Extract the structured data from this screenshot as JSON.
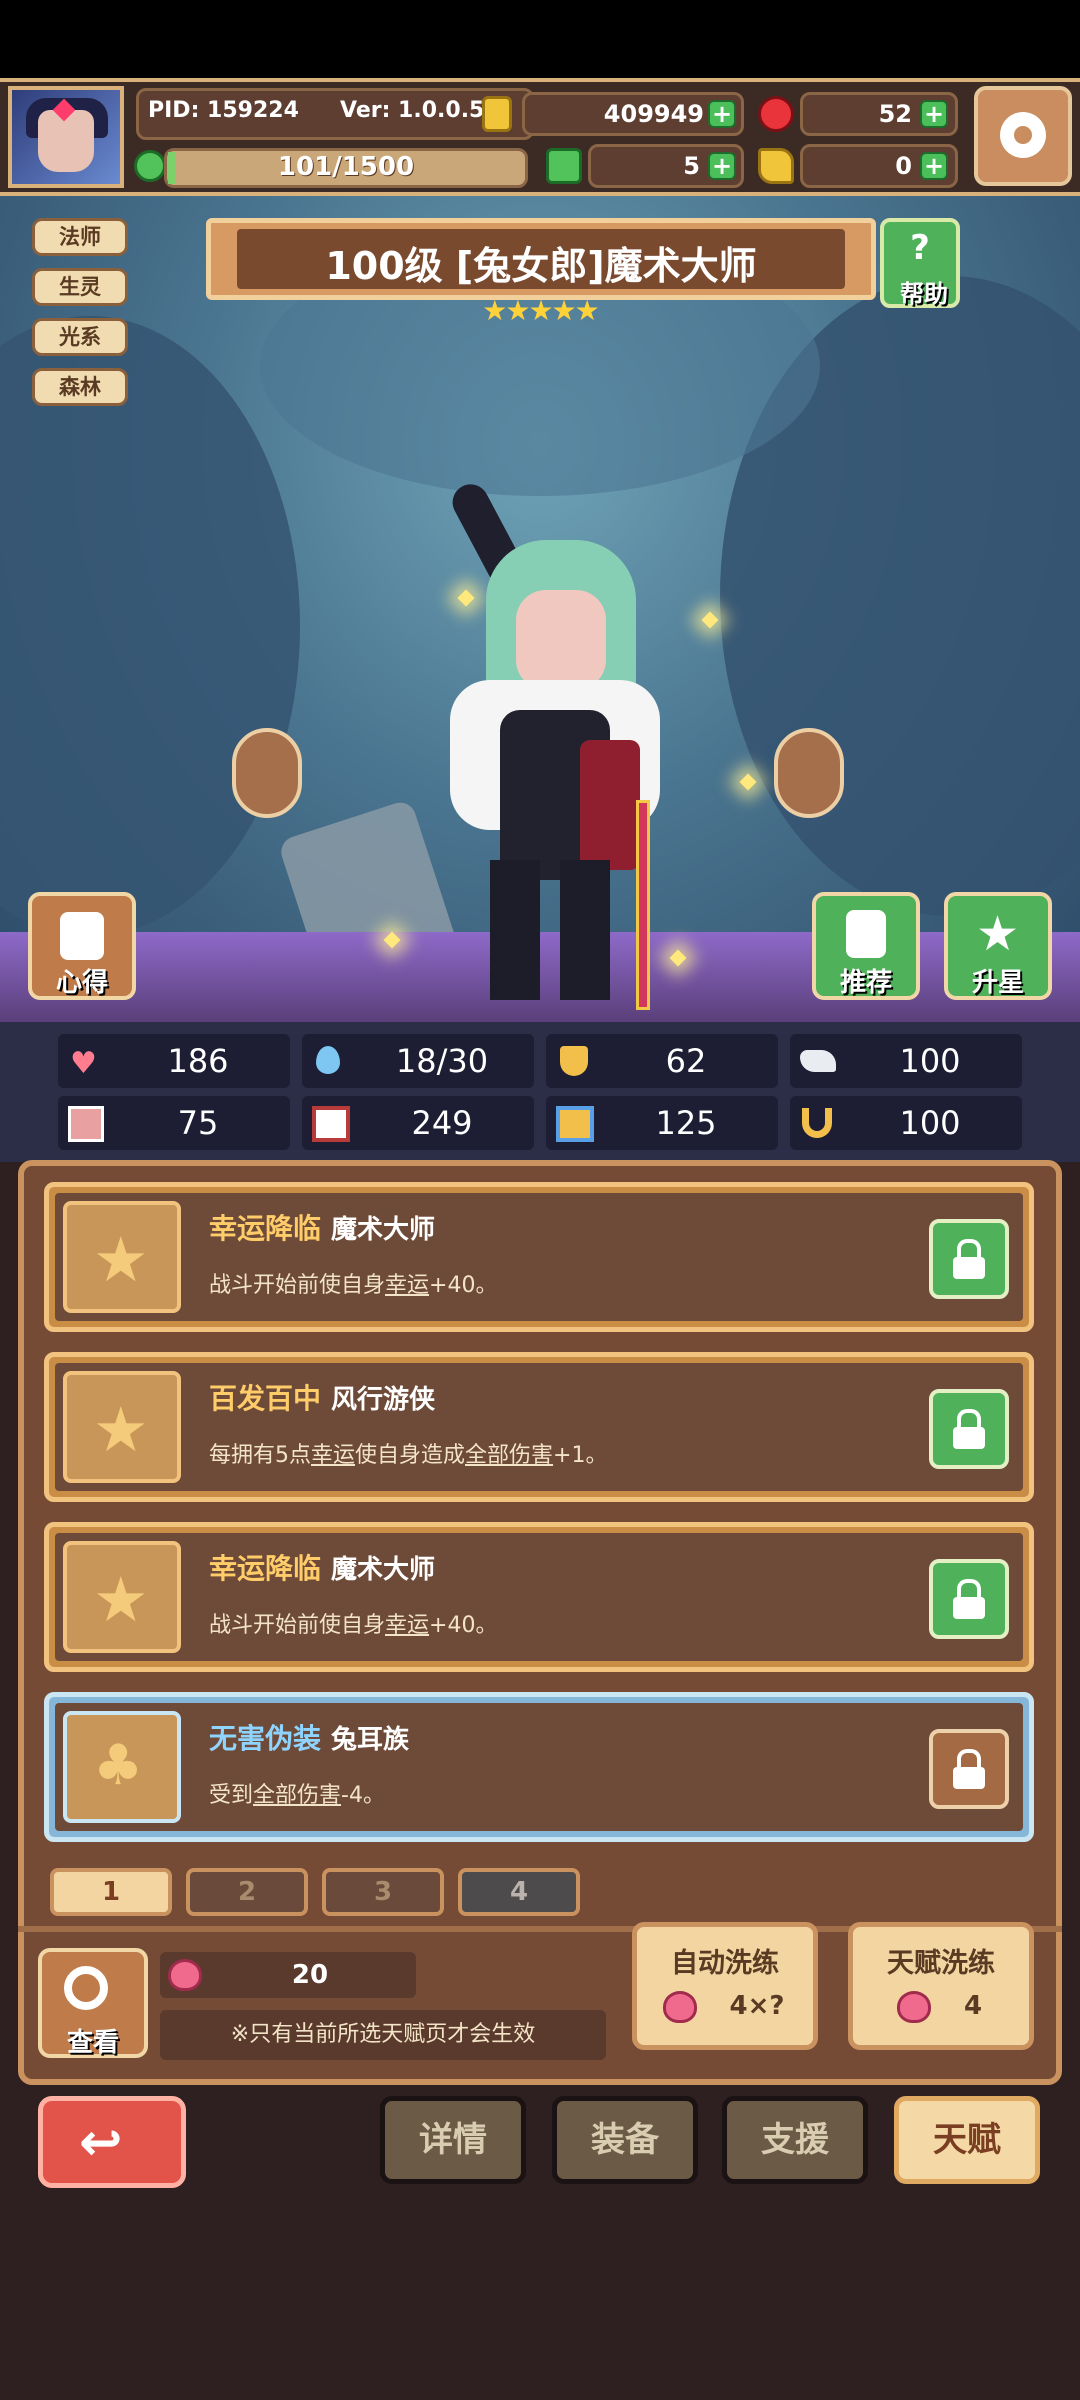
{
  "header": {
    "pid": "PID: 159224",
    "version": "Ver: 1.0.0.5",
    "gold": "409949",
    "gems": "52",
    "energy": "101/1500",
    "clover": "5",
    "key": "0"
  },
  "character": {
    "tags": [
      "法师",
      "生灵",
      "光系",
      "森林"
    ],
    "title": "100级  [兔女郎]魔术大师",
    "stars": "★★★★★",
    "help_label": "帮助",
    "tips_label": "心得",
    "recommend_label": "推荐",
    "star_up_label": "升星"
  },
  "stats": {
    "hp": "186",
    "mana": "18/30",
    "defense": "62",
    "speed": "100",
    "strength": "75",
    "intellect": "249",
    "agility": "125",
    "luck": "100"
  },
  "talents": [
    {
      "name": "幸运降临",
      "source": "魔术大师",
      "desc_prefix": "战斗开始前使自身",
      "desc_link": "幸运",
      "desc_suffix": "+40。",
      "locked": true
    },
    {
      "name": "百发百中",
      "source": "风行游侠",
      "desc_prefix": "每拥有5点",
      "desc_link": "幸运",
      "desc_mid": "使自身造成",
      "desc_link2": "全部伤害",
      "desc_suffix": "+1。",
      "locked": true
    },
    {
      "name": "幸运降临",
      "source": "魔术大师",
      "desc_prefix": "战斗开始前使自身",
      "desc_link": "幸运",
      "desc_suffix": "+40。",
      "locked": true
    },
    {
      "name": "无害伪装",
      "source": "兔耳族",
      "desc_prefix": "受到",
      "desc_link": "全部伤害",
      "desc_suffix": "-4。",
      "locked": false
    }
  ],
  "pages": [
    "1",
    "2",
    "3",
    "4"
  ],
  "controls": {
    "view_label": "查看",
    "peach_count": "20",
    "notice": "※只有当前所选天赋页才会生效",
    "auto_wash_label": "自动洗练",
    "auto_wash_cost": "4×?",
    "talent_wash_label": "天赋洗练",
    "talent_wash_cost": "4"
  },
  "nav": {
    "details": "详情",
    "equipment": "装备",
    "support": "支援",
    "talent": "天赋"
  },
  "colors": {
    "accent_gold": "#f2c37e",
    "green_button": "#4fb25b",
    "red_button": "#e2534a"
  }
}
